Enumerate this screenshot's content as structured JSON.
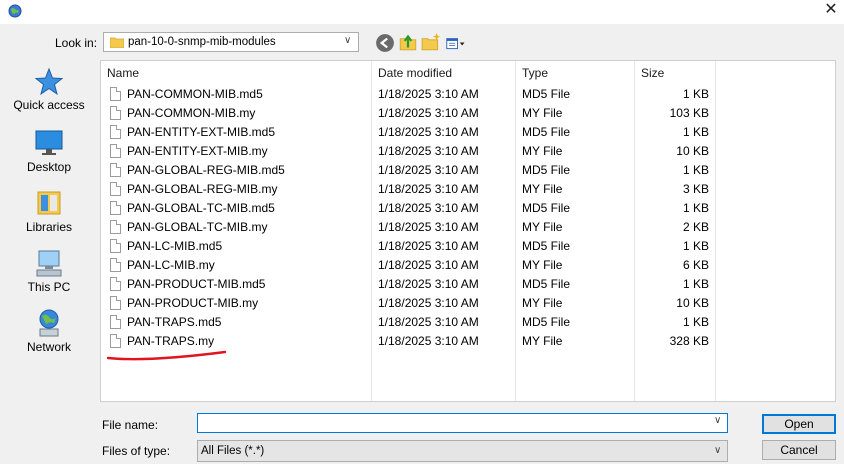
{
  "toolbar": {
    "look_in_label": "Look in:",
    "look_in_value": "pan-10-0-snmp-mib-modules"
  },
  "places": [
    {
      "label": "Quick access",
      "icon": "star-icon"
    },
    {
      "label": "Desktop",
      "icon": "desktop-icon"
    },
    {
      "label": "Libraries",
      "icon": "libraries-icon"
    },
    {
      "label": "This PC",
      "icon": "computer-icon"
    },
    {
      "label": "Network",
      "icon": "network-icon"
    }
  ],
  "columns": {
    "name": "Name",
    "date": "Date modified",
    "type": "Type",
    "size": "Size"
  },
  "files": [
    {
      "name": "PAN-COMMON-MIB.md5",
      "date": "1/18/2025 3:10 AM",
      "type": "MD5 File",
      "size": "1 KB"
    },
    {
      "name": "PAN-COMMON-MIB.my",
      "date": "1/18/2025 3:10 AM",
      "type": "MY File",
      "size": "103 KB"
    },
    {
      "name": "PAN-ENTITY-EXT-MIB.md5",
      "date": "1/18/2025 3:10 AM",
      "type": "MD5 File",
      "size": "1 KB"
    },
    {
      "name": "PAN-ENTITY-EXT-MIB.my",
      "date": "1/18/2025 3:10 AM",
      "type": "MY File",
      "size": "10 KB"
    },
    {
      "name": "PAN-GLOBAL-REG-MIB.md5",
      "date": "1/18/2025 3:10 AM",
      "type": "MD5 File",
      "size": "1 KB"
    },
    {
      "name": "PAN-GLOBAL-REG-MIB.my",
      "date": "1/18/2025 3:10 AM",
      "type": "MY File",
      "size": "3 KB"
    },
    {
      "name": "PAN-GLOBAL-TC-MIB.md5",
      "date": "1/18/2025 3:10 AM",
      "type": "MD5 File",
      "size": "1 KB"
    },
    {
      "name": "PAN-GLOBAL-TC-MIB.my",
      "date": "1/18/2025 3:10 AM",
      "type": "MY File",
      "size": "2 KB"
    },
    {
      "name": "PAN-LC-MIB.md5",
      "date": "1/18/2025 3:10 AM",
      "type": "MD5 File",
      "size": "1 KB"
    },
    {
      "name": "PAN-LC-MIB.my",
      "date": "1/18/2025 3:10 AM",
      "type": "MY File",
      "size": "6 KB"
    },
    {
      "name": "PAN-PRODUCT-MIB.md5",
      "date": "1/18/2025 3:10 AM",
      "type": "MD5 File",
      "size": "1 KB"
    },
    {
      "name": "PAN-PRODUCT-MIB.my",
      "date": "1/18/2025 3:10 AM",
      "type": "MY File",
      "size": "10 KB"
    },
    {
      "name": "PAN-TRAPS.md5",
      "date": "1/18/2025 3:10 AM",
      "type": "MD5 File",
      "size": "1 KB"
    },
    {
      "name": "PAN-TRAPS.my",
      "date": "1/18/2025 3:10 AM",
      "type": "MY File",
      "size": "328 KB"
    }
  ],
  "bottom": {
    "file_name_label": "File name:",
    "file_name_value": "",
    "file_type_label": "Files of type:",
    "file_type_value": "All Files (*.*)",
    "open_label": "Open",
    "cancel_label": "Cancel"
  },
  "colors": {
    "accent": "#0078d7",
    "annotation": "#e0141e"
  }
}
